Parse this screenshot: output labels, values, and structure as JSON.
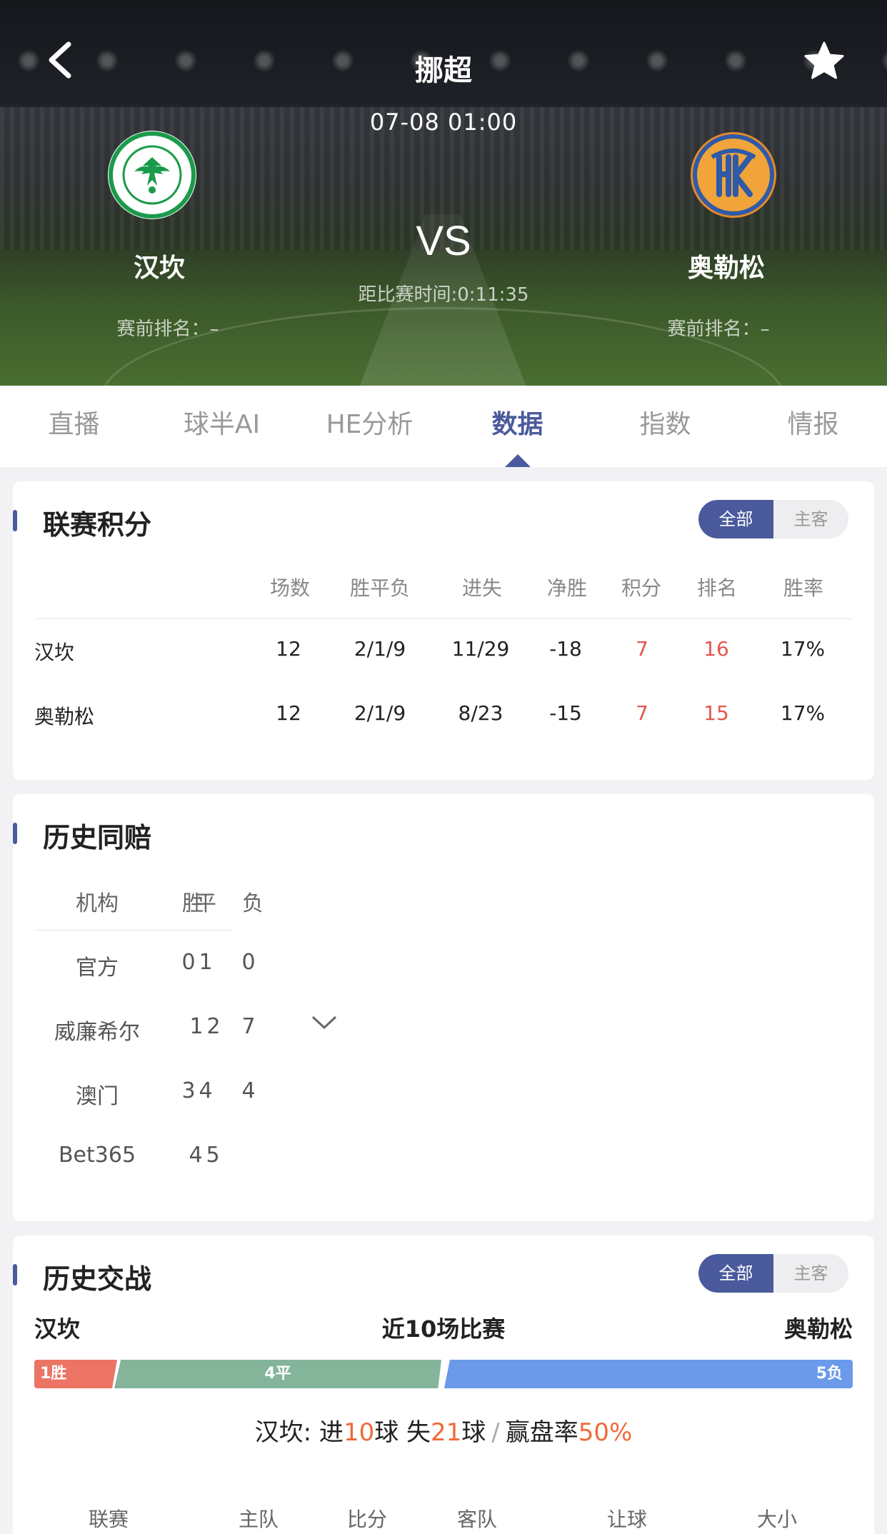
{
  "header": {
    "league": "挪超",
    "datetime": "07-08 01:00",
    "vs": "VS",
    "countdown": "距比赛时间:0:11:35",
    "home": {
      "name": "汉坎",
      "rank": "赛前排名：–",
      "logo_color": "#1a9b4a"
    },
    "away": {
      "name": "奥勒松",
      "rank": "赛前排名：–",
      "logo_color": "#e38a2b"
    }
  },
  "tabs": [
    {
      "label": "直播"
    },
    {
      "label": "球半AI"
    },
    {
      "label": "HE分析"
    },
    {
      "label": "数据",
      "active": true
    },
    {
      "label": "指数"
    },
    {
      "label": "情报"
    }
  ],
  "standings": {
    "title": "联赛积分",
    "toggle": [
      "全部",
      "主客"
    ],
    "columns": [
      "场数",
      "胜平负",
      "进失",
      "净胜",
      "积分",
      "排名",
      "胜率"
    ],
    "rows": [
      {
        "team": "汉坎",
        "played": "12",
        "wdl": "2/1/9",
        "gfga": "11/29",
        "gd": "-18",
        "pts": "7",
        "rank": "16",
        "winrate": "17%"
      },
      {
        "team": "奥勒松",
        "played": "12",
        "wdl": "2/1/9",
        "gfga": "8/23",
        "gd": "-15",
        "pts": "7",
        "rank": "15",
        "winrate": "17%"
      }
    ]
  },
  "odds": {
    "title": "历史同赔",
    "columns": [
      "机构",
      "胜",
      "平",
      "负"
    ],
    "rows": [
      {
        "name": "官方",
        "w": "0",
        "d": "1",
        "l": "0"
      },
      {
        "name": "威廉希尔",
        "w": "1",
        "d": "2",
        "l": "7"
      },
      {
        "name": "澳门",
        "w": "3",
        "d": "4",
        "l": "4"
      },
      {
        "name": "Bet365",
        "w": "4",
        "d": "5",
        "l": ""
      }
    ]
  },
  "h2h": {
    "title": "历史交战",
    "toggle": [
      "全部",
      "主客"
    ],
    "home": "汉坎",
    "middle": "近10场比赛",
    "away": "奥勒松",
    "bar": {
      "win": "1胜",
      "draw": "4平",
      "loss": "5负",
      "win_count": 1,
      "draw_count": 4,
      "loss_count": 5
    },
    "summary": {
      "prefix": "汉坎: 进",
      "goals_for": "10",
      "mid1": "球 失",
      "goals_against": "21",
      "mid2": "球",
      "sep": "/",
      "label": "赢盘率",
      "rate": "50%"
    },
    "columns": [
      "联赛",
      "主队",
      "比分",
      "客队",
      "让球",
      "大小"
    ]
  },
  "colors": {
    "accent": "#4a5a9c",
    "red": "#e2574c",
    "win": "#ec7464",
    "draw": "#84b59a",
    "loss": "#6a9ae9",
    "highlight": "#ef6a3a"
  }
}
